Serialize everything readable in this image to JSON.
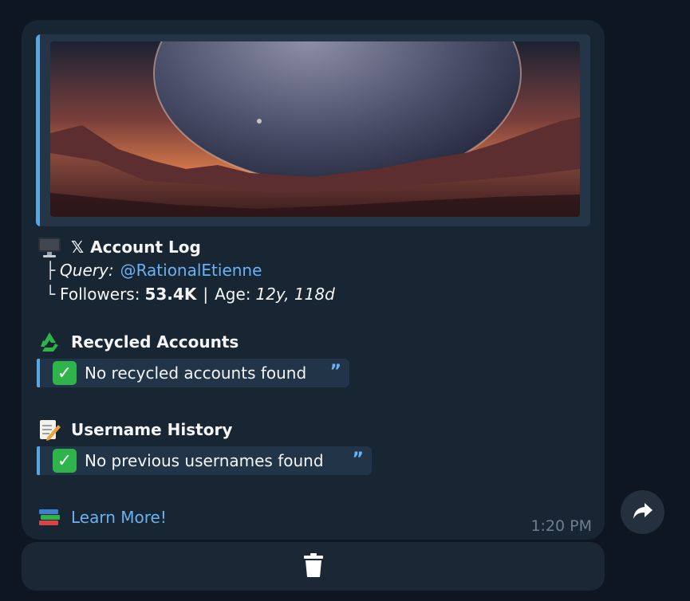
{
  "preview": {
    "image_icon": "planet-landscape-image"
  },
  "account_log": {
    "title_icon": "monitor-icon",
    "x_logo": "𝕏",
    "title": "Account Log",
    "query_tree": "├",
    "query_label": "Query:",
    "query_value": "@RationalEtienne",
    "followers_tree": "└",
    "followers_label": "Followers:",
    "followers_value": "53.4K",
    "separator": "|",
    "age_label": "Age:",
    "age_value": "12y, 118d"
  },
  "recycled": {
    "icon": "recycle-icon",
    "title": "Recycled Accounts",
    "result": "No recycled accounts found",
    "quote_icon": "quote-icon"
  },
  "history": {
    "icon": "memo-icon",
    "title": "Username History",
    "result": "No previous usernames found",
    "quote_icon": "quote-icon"
  },
  "learn": {
    "icon": "books-icon",
    "label": "Learn More!"
  },
  "message": {
    "time": "1:20 PM"
  },
  "actions": {
    "delete_icon": "trash-icon",
    "share_icon": "share-arrow-icon"
  },
  "colors": {
    "background": "#0e1621",
    "bubble": "#182533",
    "link": "#6ab2f2",
    "accent_bar": "#5aa6e0",
    "check": "#2fb34b"
  }
}
